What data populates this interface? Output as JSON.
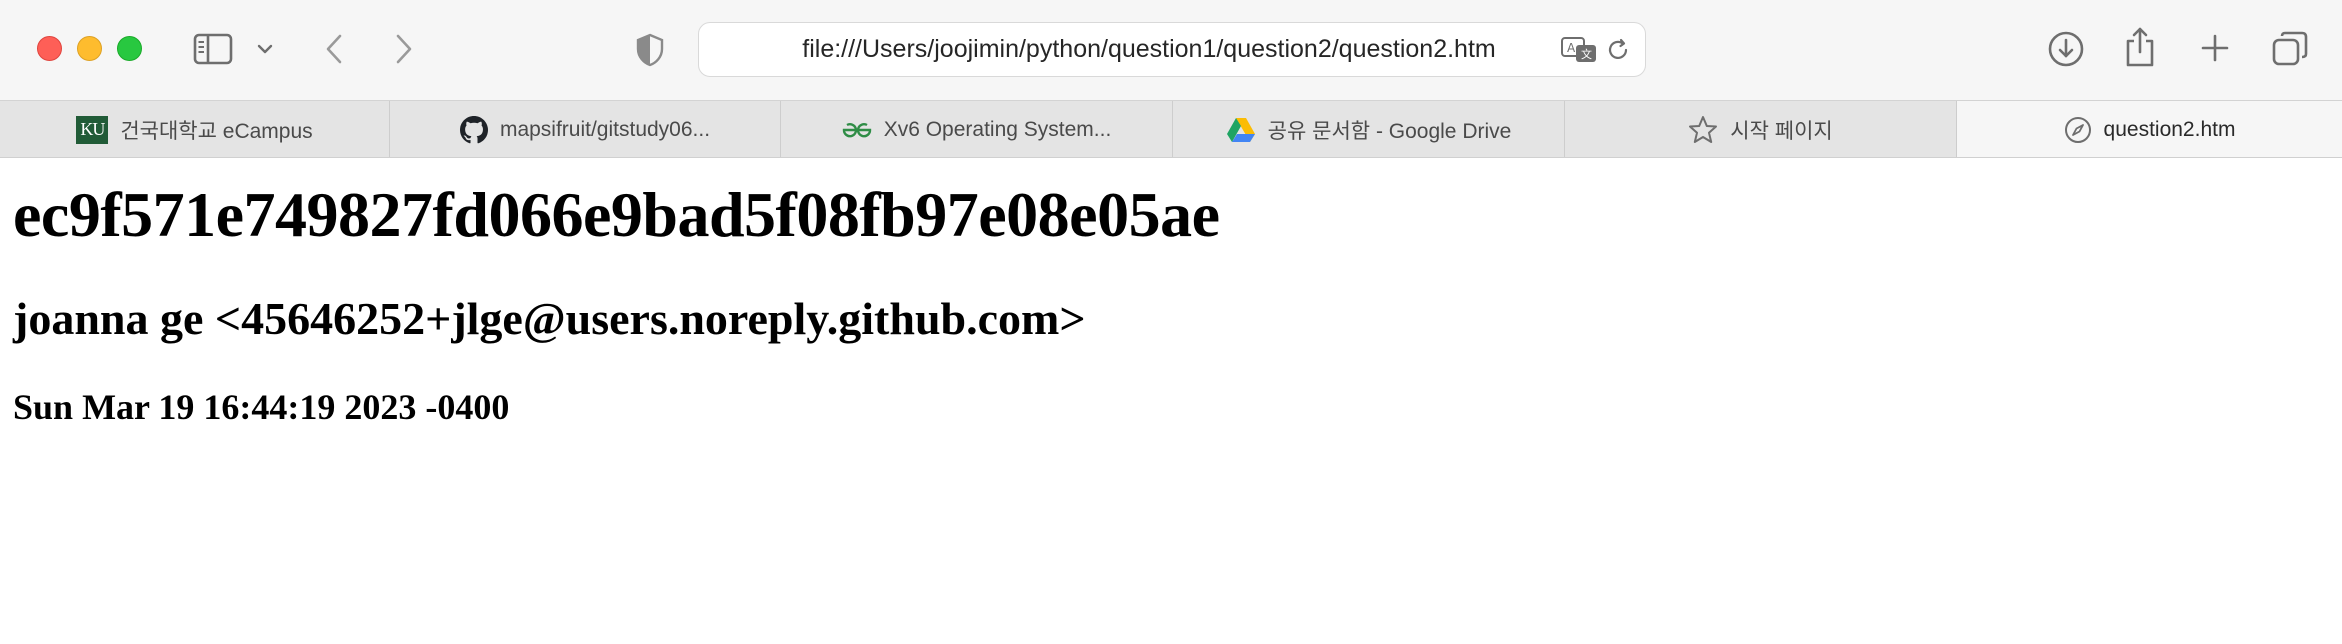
{
  "browser": {
    "url": "file:///Users/joojimin/python/question1/question2/question2.htm",
    "tabs": [
      {
        "label": "건국대학교 eCampus",
        "favicon": "ku-logo",
        "favicon_text": "KU"
      },
      {
        "label": "mapsifruit/gitstudy06...",
        "favicon": "github-icon"
      },
      {
        "label": "Xv6 Operating System...",
        "favicon": "geeksforgeeks-icon"
      },
      {
        "label": "공유 문서함 - Google Drive",
        "favicon": "google-drive-icon"
      },
      {
        "label": "시작 페이지",
        "favicon": "star-icon"
      },
      {
        "label": "question2.htm",
        "favicon": "compass-icon",
        "active": true
      }
    ],
    "toolbar_icons": [
      "sidebar-icon",
      "chevron-down-icon",
      "back-icon",
      "forward-icon",
      "privacy-shield-icon",
      "translate-icon",
      "reload-icon",
      "download-icon",
      "share-icon",
      "new-tab-icon",
      "tab-overview-icon"
    ]
  },
  "page": {
    "heading1": "ec9f571e749827fd066e9bad5f08fb97e08e05ae",
    "heading2": "joanna ge <45646252+jlge@users.noreply.github.com>",
    "heading3": "Sun Mar 19 16:44:19 2023 -0400"
  },
  "colors": {
    "close": "#fe5f57",
    "minimize": "#febc2e",
    "maximize": "#28c840",
    "ku_green": "#215b37"
  }
}
